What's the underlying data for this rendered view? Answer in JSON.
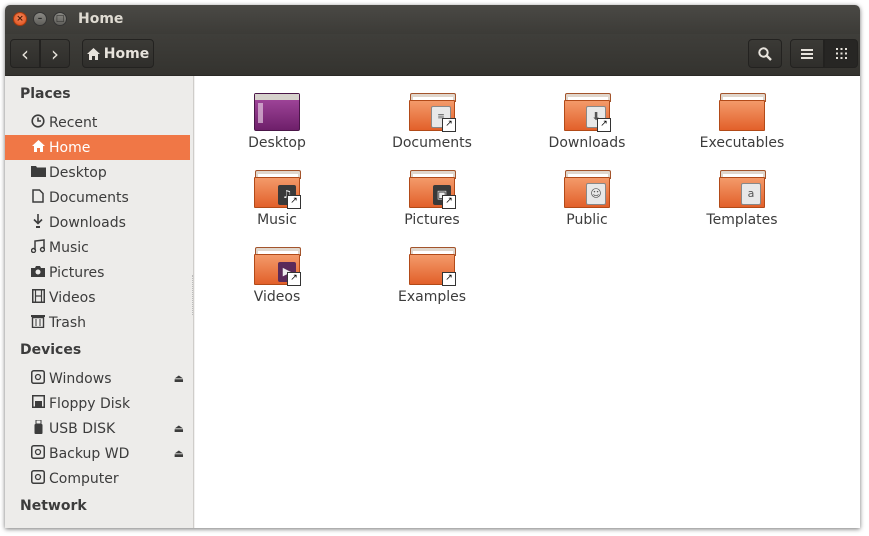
{
  "window": {
    "title": "Home"
  },
  "toolbar": {
    "path_label": "Home",
    "back_icon": "‹",
    "forward_icon": "›"
  },
  "sidebar": {
    "places_heading": "Places",
    "places": [
      {
        "label": "Recent",
        "icon": "clock-icon"
      },
      {
        "label": "Home",
        "icon": "home-icon",
        "selected": true
      },
      {
        "label": "Desktop",
        "icon": "folder-icon"
      },
      {
        "label": "Documents",
        "icon": "document-icon"
      },
      {
        "label": "Downloads",
        "icon": "download-icon"
      },
      {
        "label": "Music",
        "icon": "music-icon"
      },
      {
        "label": "Pictures",
        "icon": "camera-icon"
      },
      {
        "label": "Videos",
        "icon": "film-icon"
      },
      {
        "label": "Trash",
        "icon": "trash-icon"
      }
    ],
    "devices_heading": "Devices",
    "devices": [
      {
        "label": "Windows",
        "icon": "drive-icon",
        "eject": true
      },
      {
        "label": "Floppy Disk",
        "icon": "floppy-icon",
        "eject": false
      },
      {
        "label": "USB DISK",
        "icon": "usb-icon",
        "eject": true
      },
      {
        "label": "Backup WD",
        "icon": "drive-icon",
        "eject": true
      },
      {
        "label": "Computer",
        "icon": "drive-icon",
        "eject": false
      }
    ],
    "network_heading": "Network"
  },
  "files": [
    {
      "label": "Desktop",
      "kind": "desktop"
    },
    {
      "label": "Documents",
      "kind": "folder",
      "emblem": "document"
    },
    {
      "label": "Downloads",
      "kind": "folder",
      "emblem": "download"
    },
    {
      "label": "Executables",
      "kind": "folder",
      "emblem": "none"
    },
    {
      "label": "Music",
      "kind": "folder",
      "emblem": "music"
    },
    {
      "label": "Pictures",
      "kind": "folder",
      "emblem": "pictures"
    },
    {
      "label": "Public",
      "kind": "folder",
      "emblem": "person"
    },
    {
      "label": "Templates",
      "kind": "folder",
      "emblem": "template"
    },
    {
      "label": "Videos",
      "kind": "folder",
      "emblem": "film"
    },
    {
      "label": "Examples",
      "kind": "folder",
      "emblem": "link"
    }
  ],
  "colors": {
    "accent": "#f07746",
    "titlebar": "#3c3b37",
    "sidebar": "#edecea"
  }
}
